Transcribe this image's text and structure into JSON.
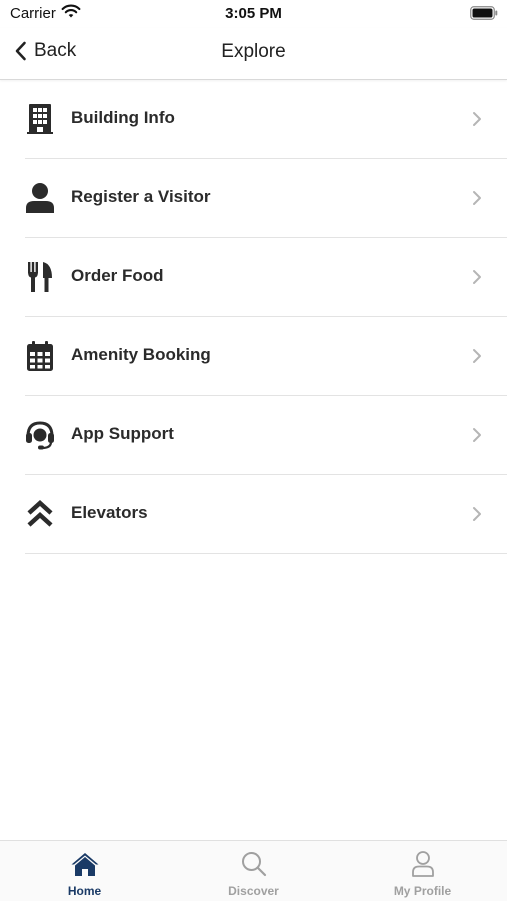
{
  "status_bar": {
    "carrier": "Carrier",
    "time": "3:05 PM"
  },
  "nav": {
    "back_label": "Back",
    "title": "Explore"
  },
  "menu": {
    "items": [
      {
        "label": "Building Info",
        "icon": "building-icon"
      },
      {
        "label": "Register a Visitor",
        "icon": "person-icon"
      },
      {
        "label": "Order Food",
        "icon": "fork-knife-icon"
      },
      {
        "label": "Amenity Booking",
        "icon": "calendar-icon"
      },
      {
        "label": "App Support",
        "icon": "headset-icon"
      },
      {
        "label": "Elevators",
        "icon": "double-chevron-up-icon"
      }
    ]
  },
  "tabs": [
    {
      "label": "Home",
      "icon": "home-icon",
      "active": true
    },
    {
      "label": "Discover",
      "icon": "search-icon",
      "active": false
    },
    {
      "label": "My Profile",
      "icon": "profile-icon",
      "active": false
    }
  ],
  "colors": {
    "active_tab": "#1a3a66",
    "inactive_tab": "#a0a0a0",
    "icon": "#2b2b2b"
  }
}
